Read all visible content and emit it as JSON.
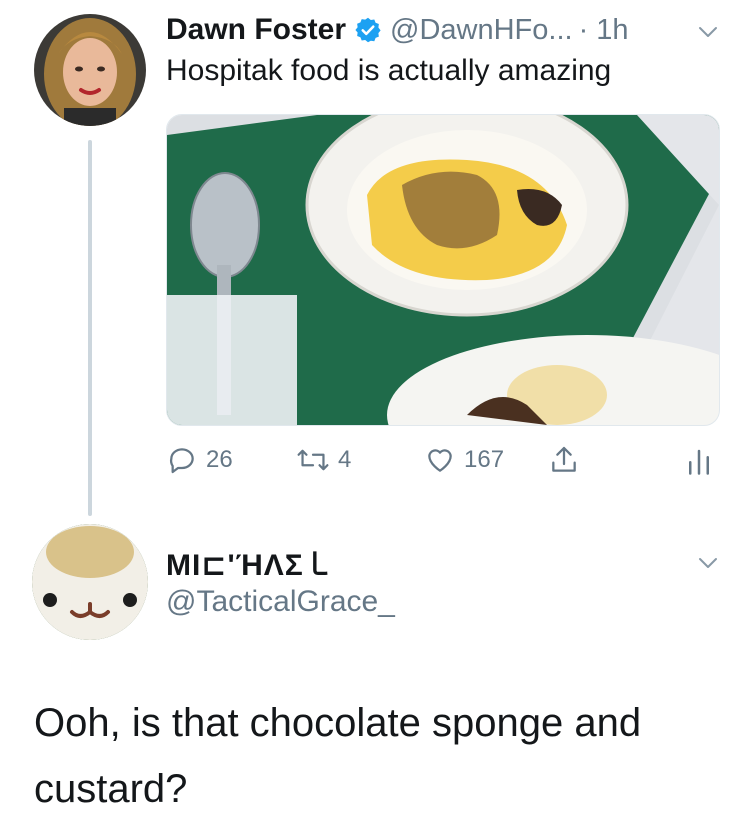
{
  "tweet": {
    "author_name": "Dawn Foster",
    "author_handle": "@DawnHFo...",
    "time": "· 1h",
    "verified": true,
    "text": "Hospitak food is actually amazing",
    "media_icon": "photo-hospital-food-tray",
    "actions": {
      "reply_count": "26",
      "retweet_count": "4",
      "like_count": "167"
    }
  },
  "reply": {
    "author_name": "MI⊏'ΉΛΣ㇄",
    "author_handle": "@TacticalGrace_",
    "text": "Ooh, is that chocolate sponge and custard?"
  },
  "colors": {
    "text": "#14171a",
    "muted": "#657786",
    "verified": "#1da1f2",
    "thread_line": "#ccd6dd"
  }
}
